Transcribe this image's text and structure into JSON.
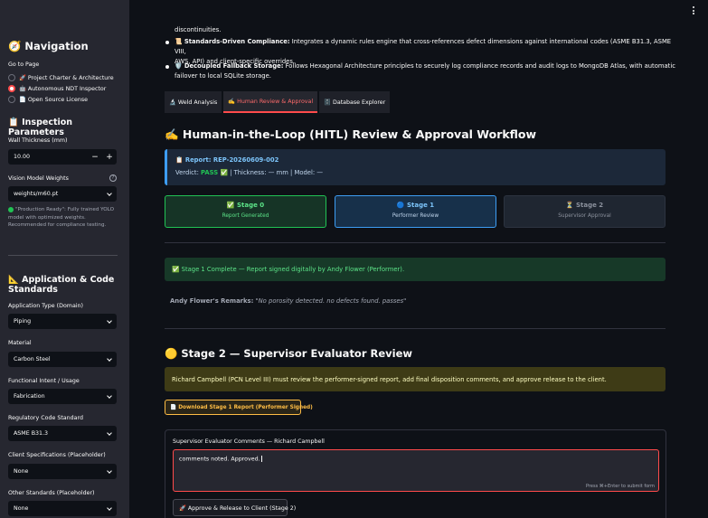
{
  "sidebar": {
    "nav_title": "🧭 Navigation",
    "goto_label": "Go to Page",
    "pages": [
      {
        "label": "🚀 Project Charter & Architecture",
        "selected": false
      },
      {
        "label": "🤖 Autonomous NDT Inspector",
        "selected": true
      },
      {
        "label": "📄 Open Source License",
        "selected": false
      }
    ],
    "params_title": "📋 Inspection Parameters",
    "wall_label": "Wall Thickness (mm)",
    "wall_value": "10.00",
    "minus": "−",
    "plus": "+",
    "weights_label": "Vision Model Weights",
    "weights_value": "weights/m60.pt",
    "help_glyph": "?",
    "note_line1": "\"Production Ready\": Fully trained YOLO",
    "note_line2": "model with optimized weights.",
    "note_line3": "Recommended for compliance testing.",
    "standards_title_1": "📐 Application & Code",
    "standards_title_2": "Standards",
    "fields": [
      {
        "label": "Application Type (Domain)",
        "value": "Piping"
      },
      {
        "label": "Material",
        "value": "Carbon Steel"
      },
      {
        "label": "Functional Intent / Usage",
        "value": "Fabrication"
      },
      {
        "label": "Regulatory Code Standard",
        "value": "ASME B31.3"
      },
      {
        "label": "Client Specifications (Placeholder)",
        "value": "None"
      },
      {
        "label": "Other Standards (Placeholder)",
        "value": "None"
      }
    ]
  },
  "main": {
    "top_line": "discontinuities.",
    "bullet1_bold": "📜 Standards-Driven Compliance:",
    "bullet1_text": " Integrates a dynamic rules engine that cross-references defect dimensions against international codes (ASME B31.3, ASME VIII,",
    "bullet1_cont": "AWS, API) and client-specific overrides.",
    "bullet2_bold": "🛡️ Decoupled Fallback Storage:",
    "bullet2_text": " Follows Hexagonal Architecture principles to securely log compliance records and audit logs to MongoDB Atlas, with automatic",
    "bullet2_cont": "failover to local SQLite storage.",
    "tabs": [
      "🔬 Weld Analysis",
      "✍️ Human Review & Approval",
      "🗄️ Database Explorer"
    ],
    "workflow_title": "✍️ Human-in-the-Loop (HITL) Review & Approval Workflow",
    "report_label": "📋 Report: REP-20260609-002",
    "verdict_prefix": "Verdict: ",
    "verdict_value": "PASS ✅",
    "verdict_rest": " | Thickness: — mm | Model: —",
    "stages": [
      {
        "title": "✅ Stage 0",
        "subtitle": "Report Generated"
      },
      {
        "title": "🔵 Stage 1",
        "subtitle": "Performer Review"
      },
      {
        "title": "⏳ Stage 2",
        "subtitle": "Supervisor Approval"
      }
    ],
    "success_text": "✅ Stage 1 Complete — Report signed digitally by Andy Flower (Performer).",
    "remarks_label": "Andy Flower's Remarks:",
    "remarks_text": "\"No porosity detected. no defects found. passes\"",
    "stage2_title": "🟡 Stage 2 — Supervisor Evaluator Review",
    "warn_text": "Richard Campbell (PCN Level III) must review the performer-signed report, add final disposition comments, and approve release to the client.",
    "download_label": "📄 Download Stage 1 Report (Performer Signed)",
    "comments_label": "Supervisor Evaluator Comments — Richard Campbell",
    "comments_value": "comments noted. Approved.",
    "submit_hint": "Press ⌘+Enter to submit form",
    "approve_label": "🚀 Approve & Release to Client (Stage 2)"
  },
  "colors": {
    "accent": "#ff4b4b",
    "success": "#21c354",
    "info": "#3d9df3",
    "warning": "#ffbd45"
  }
}
